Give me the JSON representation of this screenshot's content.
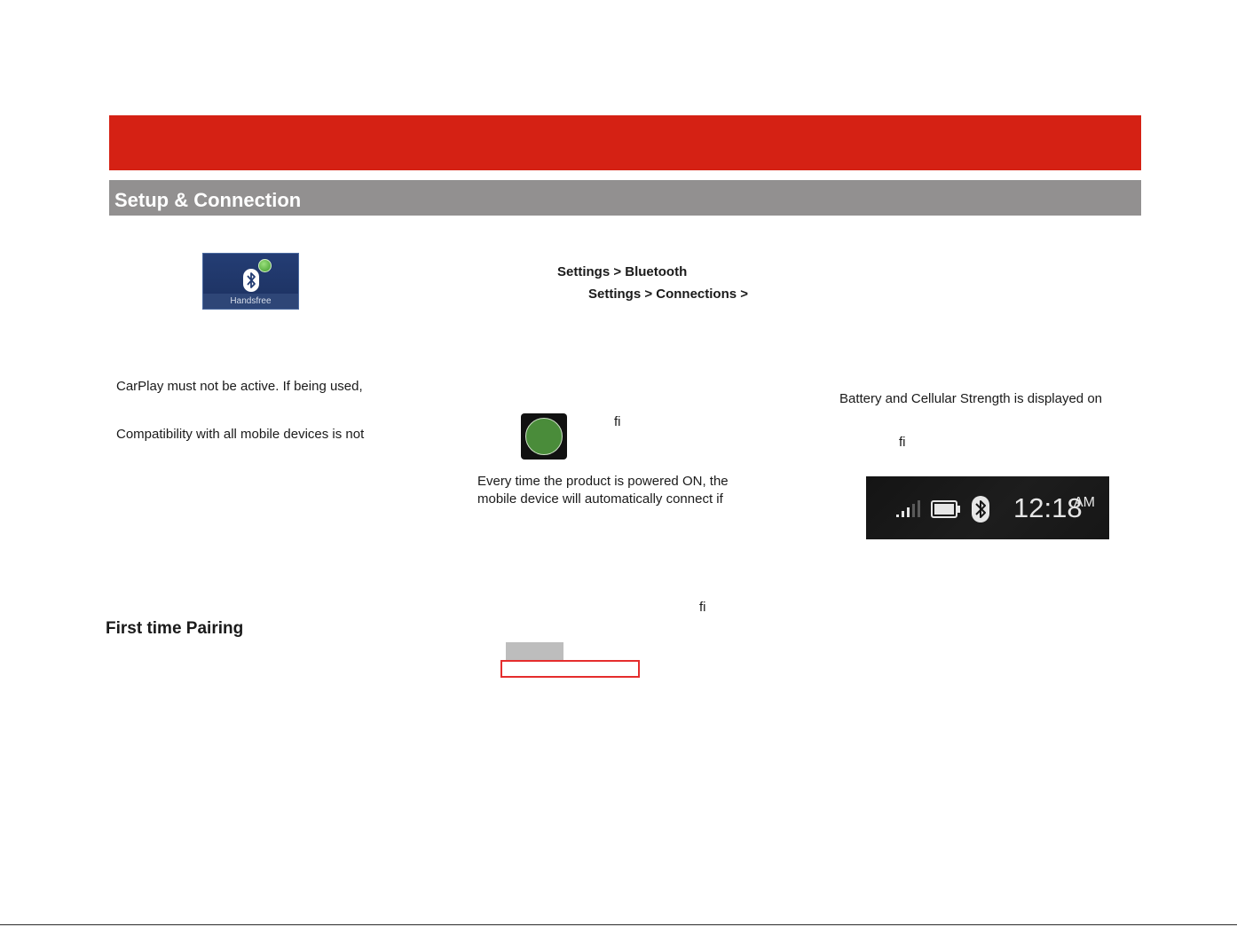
{
  "header": {
    "section_title": "Setup & Connection"
  },
  "left_column": {
    "handsfree_tile": {
      "icon": "bluetooth-icon",
      "badge_icon": "phone-badge-icon",
      "label": "Handsfree"
    },
    "line_carplay": "CarPlay must not be active. If being used,",
    "line_compatibility": "Compatibility with all mobile devices is not",
    "subheading": "First time Pairing"
  },
  "middle_column": {
    "path_bluetooth": "Settings > Bluetooth",
    "path_connections": "Settings > Connections >",
    "fi_glyph_1": "fi",
    "power_line_1": "Every time the product is powered ON, the",
    "power_line_2": "mobile device will automatically connect if",
    "fi_glyph_2": "fi"
  },
  "right_column": {
    "battery_line": "Battery and Cellular Strength is displayed on",
    "fi_glyph": "fi",
    "status_bar": {
      "icons": [
        "signal-icon",
        "battery-icon",
        "bluetooth-icon"
      ],
      "time": "12:18",
      "ampm": "AM"
    }
  },
  "colors": {
    "banner_red": "#d52114",
    "section_gray": "#929090",
    "handsfree_blue": "#243d74",
    "button_green": "#4a8c3a",
    "outline_red": "#e52d2d"
  }
}
